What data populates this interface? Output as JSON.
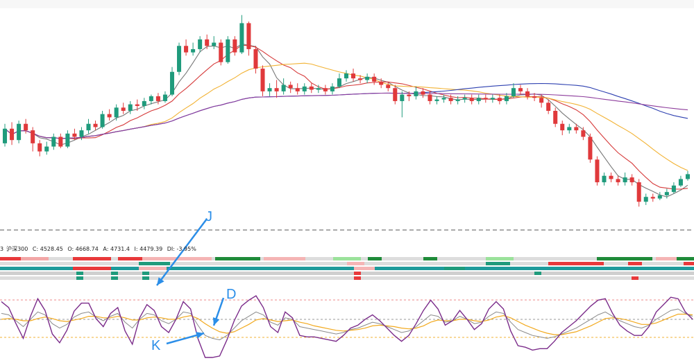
{
  "info_bar": {
    "prefix": "3",
    "name": "沪深300",
    "close": "C: 4528.45",
    "open": "O: 4668.74",
    "high": "A: 4731.4",
    "low": "I: 4479.39",
    "diff": "DI: -3.95%"
  },
  "annotations": {
    "j": "J",
    "d": "D",
    "k": "K"
  },
  "colors": {
    "up": "#1f9b7c",
    "down": "#e0393b",
    "ma5": "#777777",
    "ma10": "#d63a3a",
    "ma20": "#f2b233",
    "ma60": "#2c3fb0",
    "ma120": "#8c3b9b",
    "k": "#8a8a8a",
    "d": "#f2a91d",
    "j": "#7b2c8a",
    "arrow": "#2b8ee8"
  },
  "chart_data": {
    "type": "candlestick",
    "candles": [
      {
        "o": 4000,
        "c": 4045,
        "h": 4060,
        "l": 3990
      },
      {
        "o": 4045,
        "c": 4010,
        "h": 4065,
        "l": 3995
      },
      {
        "o": 4010,
        "c": 4060,
        "h": 4070,
        "l": 4000
      },
      {
        "o": 4060,
        "c": 4040,
        "h": 4075,
        "l": 4030
      },
      {
        "o": 4040,
        "c": 4000,
        "h": 4050,
        "l": 3975
      },
      {
        "o": 4000,
        "c": 3975,
        "h": 4010,
        "l": 3960
      },
      {
        "o": 3975,
        "c": 3990,
        "h": 4005,
        "l": 3965
      },
      {
        "o": 3990,
        "c": 4020,
        "h": 4030,
        "l": 3980
      },
      {
        "o": 4020,
        "c": 3990,
        "h": 4030,
        "l": 3985
      },
      {
        "o": 3990,
        "c": 4030,
        "h": 4040,
        "l": 3985
      },
      {
        "o": 4030,
        "c": 4020,
        "h": 4045,
        "l": 4010
      },
      {
        "o": 4020,
        "c": 4040,
        "h": 4050,
        "l": 4010
      },
      {
        "o": 4040,
        "c": 4060,
        "h": 4075,
        "l": 4030
      },
      {
        "o": 4060,
        "c": 4050,
        "h": 4070,
        "l": 4040
      },
      {
        "o": 4050,
        "c": 4090,
        "h": 4100,
        "l": 4045
      },
      {
        "o": 4090,
        "c": 4080,
        "h": 4105,
        "l": 4070
      },
      {
        "o": 4080,
        "c": 4110,
        "h": 4120,
        "l": 4070
      },
      {
        "o": 4110,
        "c": 4100,
        "h": 4125,
        "l": 4090
      },
      {
        "o": 4100,
        "c": 4120,
        "h": 4130,
        "l": 4090
      },
      {
        "o": 4120,
        "c": 4115,
        "h": 4135,
        "l": 4100
      },
      {
        "o": 4115,
        "c": 4130,
        "h": 4140,
        "l": 4105
      },
      {
        "o": 4130,
        "c": 4145,
        "h": 4150,
        "l": 4120
      },
      {
        "o": 4145,
        "c": 4130,
        "h": 4155,
        "l": 4120
      },
      {
        "o": 4130,
        "c": 4150,
        "h": 4160,
        "l": 4125
      },
      {
        "o": 4150,
        "c": 4220,
        "h": 4235,
        "l": 4145
      },
      {
        "o": 4220,
        "c": 4300,
        "h": 4310,
        "l": 4210
      },
      {
        "o": 4300,
        "c": 4280,
        "h": 4320,
        "l": 4270
      },
      {
        "o": 4280,
        "c": 4290,
        "h": 4310,
        "l": 4270
      },
      {
        "o": 4290,
        "c": 4320,
        "h": 4330,
        "l": 4280
      },
      {
        "o": 4320,
        "c": 4300,
        "h": 4335,
        "l": 4290
      },
      {
        "o": 4300,
        "c": 4310,
        "h": 4330,
        "l": 4290
      },
      {
        "o": 4310,
        "c": 4250,
        "h": 4320,
        "l": 4240
      },
      {
        "o": 4250,
        "c": 4320,
        "h": 4330,
        "l": 4245
      },
      {
        "o": 4320,
        "c": 4280,
        "h": 4330,
        "l": 4270
      },
      {
        "o": 4280,
        "c": 4370,
        "h": 4395,
        "l": 4275
      },
      {
        "o": 4370,
        "c": 4290,
        "h": 4375,
        "l": 4270
      },
      {
        "o": 4290,
        "c": 4230,
        "h": 4300,
        "l": 4215
      },
      {
        "o": 4230,
        "c": 4160,
        "h": 4240,
        "l": 4145
      },
      {
        "o": 4160,
        "c": 4170,
        "h": 4185,
        "l": 4145
      },
      {
        "o": 4170,
        "c": 4160,
        "h": 4195,
        "l": 4140
      },
      {
        "o": 4160,
        "c": 4180,
        "h": 4200,
        "l": 4150
      },
      {
        "o": 4180,
        "c": 4170,
        "h": 4190,
        "l": 4155
      },
      {
        "o": 4170,
        "c": 4160,
        "h": 4185,
        "l": 4150
      },
      {
        "o": 4160,
        "c": 4175,
        "h": 4185,
        "l": 4150
      },
      {
        "o": 4175,
        "c": 4165,
        "h": 4185,
        "l": 4155
      },
      {
        "o": 4165,
        "c": 4170,
        "h": 4180,
        "l": 4155
      },
      {
        "o": 4170,
        "c": 4160,
        "h": 4180,
        "l": 4150
      },
      {
        "o": 4160,
        "c": 4175,
        "h": 4185,
        "l": 4150
      },
      {
        "o": 4175,
        "c": 4200,
        "h": 4215,
        "l": 4170
      },
      {
        "o": 4200,
        "c": 4215,
        "h": 4225,
        "l": 4190
      },
      {
        "o": 4215,
        "c": 4200,
        "h": 4230,
        "l": 4190
      },
      {
        "o": 4200,
        "c": 4195,
        "h": 4210,
        "l": 4185
      },
      {
        "o": 4195,
        "c": 4205,
        "h": 4215,
        "l": 4185
      },
      {
        "o": 4205,
        "c": 4190,
        "h": 4215,
        "l": 4180
      },
      {
        "o": 4190,
        "c": 4180,
        "h": 4200,
        "l": 4170
      },
      {
        "o": 4180,
        "c": 4170,
        "h": 4190,
        "l": 4160
      },
      {
        "o": 4170,
        "c": 4130,
        "h": 4180,
        "l": 4120
      },
      {
        "o": 4130,
        "c": 4150,
        "h": 4160,
        "l": 4080
      },
      {
        "o": 4150,
        "c": 4145,
        "h": 4160,
        "l": 4130
      },
      {
        "o": 4145,
        "c": 4160,
        "h": 4175,
        "l": 4135
      },
      {
        "o": 4160,
        "c": 4150,
        "h": 4170,
        "l": 4140
      },
      {
        "o": 4150,
        "c": 4130,
        "h": 4160,
        "l": 4120
      },
      {
        "o": 4130,
        "c": 4135,
        "h": 4145,
        "l": 4120
      },
      {
        "o": 4135,
        "c": 4140,
        "h": 4150,
        "l": 4125
      },
      {
        "o": 4140,
        "c": 4130,
        "h": 4150,
        "l": 4120
      },
      {
        "o": 4130,
        "c": 4135,
        "h": 4145,
        "l": 4120
      },
      {
        "o": 4135,
        "c": 4140,
        "h": 4150,
        "l": 4125
      },
      {
        "o": 4140,
        "c": 4130,
        "h": 4150,
        "l": 4120
      },
      {
        "o": 4130,
        "c": 4140,
        "h": 4150,
        "l": 4120
      },
      {
        "o": 4140,
        "c": 4135,
        "h": 4150,
        "l": 4125
      },
      {
        "o": 4135,
        "c": 4140,
        "h": 4150,
        "l": 4125
      },
      {
        "o": 4140,
        "c": 4130,
        "h": 4150,
        "l": 4120
      },
      {
        "o": 4130,
        "c": 4145,
        "h": 4155,
        "l": 4120
      },
      {
        "o": 4145,
        "c": 4170,
        "h": 4185,
        "l": 4140
      },
      {
        "o": 4170,
        "c": 4160,
        "h": 4180,
        "l": 4150
      },
      {
        "o": 4160,
        "c": 4145,
        "h": 4170,
        "l": 4135
      },
      {
        "o": 4145,
        "c": 4140,
        "h": 4155,
        "l": 4130
      },
      {
        "o": 4140,
        "c": 4125,
        "h": 4150,
        "l": 4110
      },
      {
        "o": 4125,
        "c": 4100,
        "h": 4135,
        "l": 4090
      },
      {
        "o": 4100,
        "c": 4060,
        "h": 4110,
        "l": 4050
      },
      {
        "o": 4060,
        "c": 4040,
        "h": 4070,
        "l": 4025
      },
      {
        "o": 4040,
        "c": 4050,
        "h": 4060,
        "l": 4030
      },
      {
        "o": 4050,
        "c": 4040,
        "h": 4060,
        "l": 4030
      },
      {
        "o": 4040,
        "c": 4020,
        "h": 4050,
        "l": 4010
      },
      {
        "o": 4020,
        "c": 3950,
        "h": 4030,
        "l": 3940
      },
      {
        "o": 3950,
        "c": 3880,
        "h": 3960,
        "l": 3870
      },
      {
        "o": 3880,
        "c": 3900,
        "h": 3910,
        "l": 3870
      },
      {
        "o": 3900,
        "c": 3890,
        "h": 3910,
        "l": 3880
      },
      {
        "o": 3890,
        "c": 3880,
        "h": 3900,
        "l": 3870
      },
      {
        "o": 3880,
        "c": 3895,
        "h": 3910,
        "l": 3870
      },
      {
        "o": 3895,
        "c": 3880,
        "h": 3905,
        "l": 3870
      },
      {
        "o": 3880,
        "c": 3820,
        "h": 3890,
        "l": 3805
      },
      {
        "o": 3820,
        "c": 3835,
        "h": 3845,
        "l": 3810
      },
      {
        "o": 3835,
        "c": 3830,
        "h": 3845,
        "l": 3820
      },
      {
        "o": 3830,
        "c": 3840,
        "h": 3850,
        "l": 3825
      },
      {
        "o": 3840,
        "c": 3850,
        "h": 3860,
        "l": 3830
      },
      {
        "o": 3850,
        "c": 3870,
        "h": 3880,
        "l": 3845
      },
      {
        "o": 3870,
        "c": 3890,
        "h": 3900,
        "l": 3865
      },
      {
        "o": 3890,
        "c": 3905,
        "h": 3915,
        "l": 3885
      }
    ],
    "indicator_kdj": {
      "k": [
        60,
        58,
        50,
        42,
        52,
        62,
        58,
        46,
        40,
        45,
        55,
        60,
        62,
        55,
        50,
        56,
        60,
        48,
        40,
        52,
        60,
        58,
        50,
        46,
        52,
        62,
        60,
        44,
        30,
        26,
        24,
        30,
        40,
        50,
        56,
        62,
        58,
        48,
        44,
        54,
        52,
        42,
        40,
        38,
        36,
        34,
        32,
        34,
        38,
        40,
        44,
        48,
        46,
        42,
        38,
        34,
        36,
        42,
        50,
        58,
        56,
        48,
        50,
        56,
        52,
        46,
        48,
        56,
        62,
        60,
        48,
        38,
        34,
        30,
        28,
        26,
        28,
        32,
        36,
        40,
        46,
        52,
        58,
        62,
        56,
        50,
        46,
        42,
        40,
        44,
        52,
        58,
        64,
        66,
        60,
        56
      ],
      "d": [
        52,
        53,
        52,
        50,
        50,
        53,
        55,
        53,
        50,
        49,
        51,
        53,
        56,
        56,
        54,
        54,
        56,
        54,
        51,
        51,
        54,
        55,
        54,
        52,
        52,
        55,
        57,
        53,
        46,
        40,
        35,
        33,
        35,
        40,
        45,
        51,
        53,
        51,
        49,
        50,
        51,
        48,
        46,
        43,
        41,
        39,
        37,
        36,
        37,
        38,
        40,
        43,
        44,
        43,
        42,
        40,
        39,
        40,
        43,
        48,
        51,
        50,
        50,
        52,
        52,
        50,
        49,
        51,
        55,
        57,
        54,
        49,
        44,
        40,
        36,
        33,
        31,
        31,
        33,
        35,
        39,
        43,
        48,
        53,
        54,
        53,
        51,
        48,
        45,
        45,
        47,
        51,
        55,
        59,
        59,
        58
      ],
      "j": [
        76,
        68,
        46,
        26,
        56,
        80,
        64,
        32,
        20,
        37,
        63,
        74,
        74,
        53,
        42,
        60,
        68,
        36,
        18,
        54,
        72,
        64,
        42,
        34,
        52,
        76,
        66,
        26,
        0,
        0,
        2,
        24,
        50,
        70,
        78,
        84,
        68,
        42,
        34,
        62,
        54,
        30,
        28,
        28,
        26,
        24,
        22,
        30,
        40,
        44,
        52,
        58,
        50,
        40,
        30,
        22,
        30,
        46,
        64,
        78,
        66,
        44,
        50,
        64,
        52,
        38,
        46,
        66,
        76,
        66,
        36,
        16,
        14,
        10,
        12,
        12,
        22,
        34,
        42,
        50,
        60,
        70,
        78,
        80,
        60,
        44,
        36,
        30,
        30,
        42,
        62,
        72,
        82,
        80,
        62,
        52
      ]
    }
  }
}
